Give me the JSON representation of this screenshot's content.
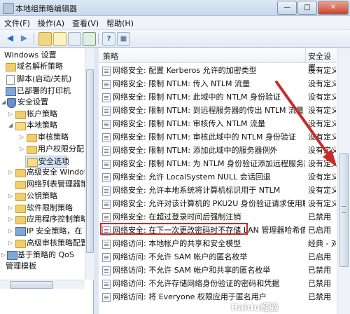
{
  "window": {
    "title": "本地组策略编辑器",
    "buttons": {
      "minimize": "—",
      "maximize": "□",
      "close": "✕"
    }
  },
  "menu": [
    "文件(F)",
    "操作(A)",
    "查看(V)",
    "帮助(H)"
  ],
  "toolbar": {
    "icons": [
      "back-icon",
      "forward-icon",
      "up-folder-icon",
      "show-tree-icon",
      "refresh-icon",
      "export-icon",
      "help-icon",
      "properties-icon"
    ],
    "back_glyph": "◀",
    "forward_glyph": "▶",
    "help_glyph": "?",
    "props_glyph": "▦"
  },
  "tree": {
    "items": [
      {
        "label": "Windows 设置",
        "icon": "none",
        "expand": ""
      },
      {
        "label": "域名解析策略",
        "icon": "folder",
        "expand": ""
      },
      {
        "label": "脚本(启动/关机)",
        "icon": "doc",
        "expand": ""
      },
      {
        "label": "已部署的打印机",
        "icon": "pc",
        "expand": ""
      },
      {
        "label": "安全设置",
        "icon": "shield",
        "expand": "◢"
      },
      {
        "label": "帐户策略",
        "icon": "folder",
        "expand": "▷"
      },
      {
        "label": "本地策略",
        "icon": "folder",
        "expand": "◢"
      },
      {
        "label": "审核策略",
        "icon": "folder",
        "expand": "▷"
      },
      {
        "label": "用户权限分配",
        "icon": "folder",
        "expand": "▷"
      },
      {
        "label": "安全选项",
        "icon": "folder-open",
        "expand": ""
      },
      {
        "label": "高级安全 Window",
        "icon": "folder",
        "expand": "▷"
      },
      {
        "label": "网络列表管理器策",
        "icon": "folder",
        "expand": ""
      },
      {
        "label": "公钥策略",
        "icon": "folder",
        "expand": "▷"
      },
      {
        "label": "软件限制策略",
        "icon": "folder",
        "expand": "▷"
      },
      {
        "label": "应用程序控制策略",
        "icon": "folder",
        "expand": "▷"
      },
      {
        "label": "IP 安全策略，在",
        "icon": "pc",
        "expand": "▷"
      },
      {
        "label": "高级审核策略配置",
        "icon": "folder",
        "expand": "▷"
      },
      {
        "label": "基于策略的 QoS",
        "icon": "pc",
        "expand": "▷"
      },
      {
        "label": "管理模板",
        "icon": "none",
        "expand": ""
      }
    ]
  },
  "list": {
    "columns": [
      "策略",
      "安全设置"
    ],
    "rows": [
      {
        "name": "网络安全: 配置 Kerberos 允许的加密类型",
        "value": "没有定义"
      },
      {
        "name": "网络安全: 限制 NTLM: 传入 NTLM 流量",
        "value": "没有定义"
      },
      {
        "name": "网络安全: 限制 NTLM: 此域中的 NTLM 身份验证",
        "value": "没有定义"
      },
      {
        "name": "网络安全: 限制 NTLM: 到远程服务器的传出 NTLM 流量",
        "value": "没有定义"
      },
      {
        "name": "网络安全: 限制 NTLM: 审核传入 NTLM 流量",
        "value": "没有定义"
      },
      {
        "name": "网络安全: 限制 NTLM: 审核此域中的 NTLM 身份验证",
        "value": "没有定义"
      },
      {
        "name": "网络安全: 限制 NTLM: 添加此域中的服务器例外",
        "value": "没有定义"
      },
      {
        "name": "网络安全: 限制 NTLM: 为 NTLM 身份验证添加远程服务器...",
        "value": "没有定义"
      },
      {
        "name": "网络安全: 允许 LocalSystem NULL 会话回退",
        "value": "没有定义"
      },
      {
        "name": "网络安全: 允许本地系统将计算机标识用于 NTLM",
        "value": "没有定义"
      },
      {
        "name": "网络安全: 允许对该计算机的 PKU2U 身份验证请求使用联...",
        "value": "没有定义"
      },
      {
        "name": "网络安全: 在超过登录时间后强制注销",
        "value": "已禁用"
      },
      {
        "name": "网络安全: 在下一次更改密码时不存储 LAN 管理器哈希值",
        "value": "已启用"
      },
      {
        "name": "网络访问: 本地帐户的共享和安全模型",
        "value": "经典 - 对"
      },
      {
        "name": "网络访问: 不允许 SAM 帐户的匿名枚举",
        "value": "已启用"
      },
      {
        "name": "网络访问: 不允许 SAM 帐户和共享的匿名枚举",
        "value": "已禁用"
      },
      {
        "name": "网络访问: 不允许存储网络身份验证的密码和凭据",
        "value": "已禁用"
      },
      {
        "name": "网络访问: 将 Everyone 权限应用于匿名用户",
        "value": "已禁用"
      }
    ],
    "highlighted_row": 13
  },
  "annotation": {
    "arrow_color": "#c92a2a",
    "box_color": "#c92a2a"
  },
  "watermark": "Baidu经验"
}
